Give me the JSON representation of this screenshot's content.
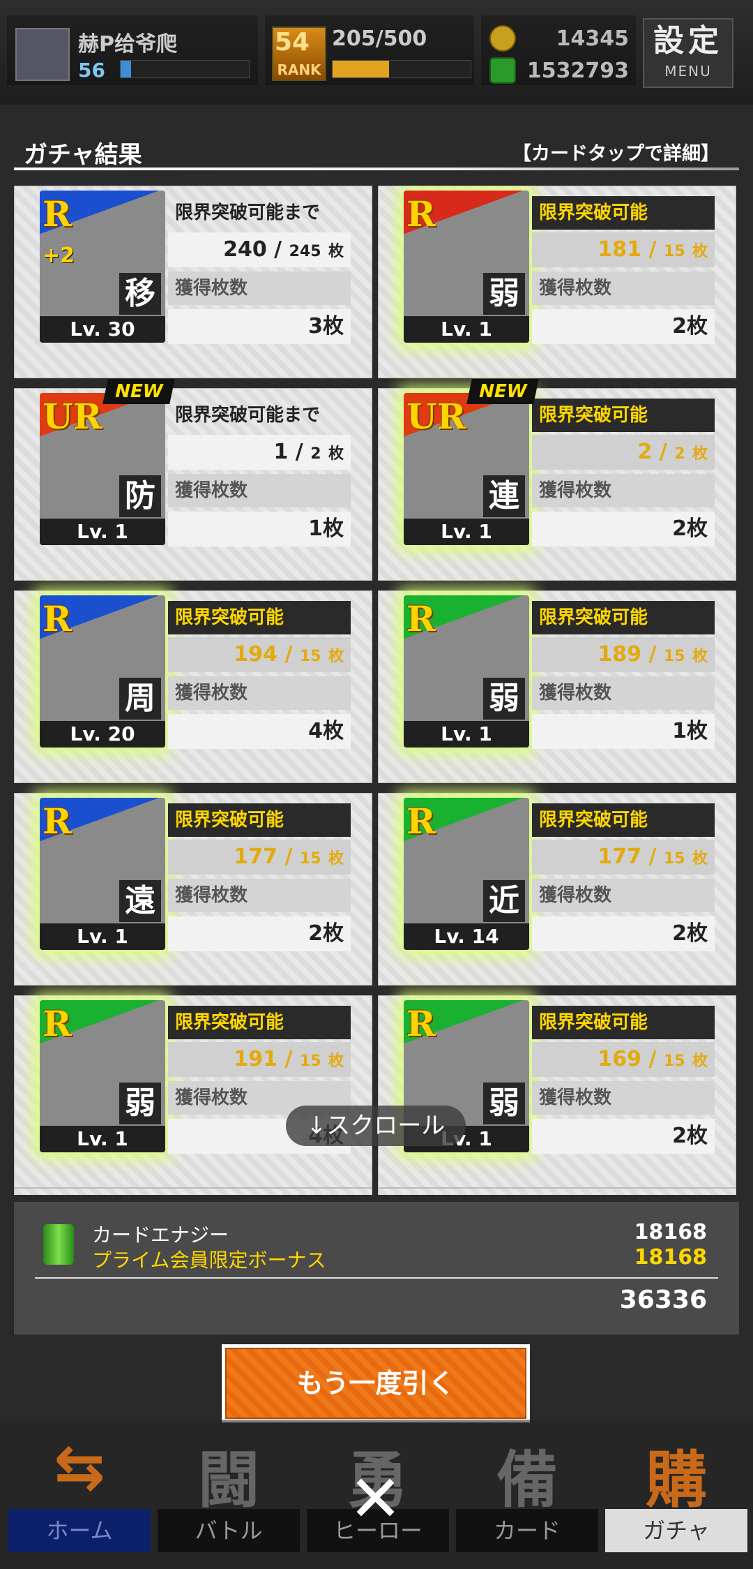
{
  "player": {
    "name": "赫P给爷爬",
    "level": "56",
    "xp_fraction": 0.08
  },
  "rank": {
    "label": "RANK",
    "value": "54",
    "progress": "205/500",
    "fraction": 0.41
  },
  "currency": {
    "coins": "14345",
    "energy": "1532793"
  },
  "menu": {
    "kanji": "設定",
    "label": "MENU"
  },
  "header": {
    "title": "ガチャ結果",
    "hint": "【カードタップで詳細】"
  },
  "cards": [
    {
      "rarity": "R",
      "plus": "+2",
      "kanji": "移",
      "level": "Lv. 30",
      "status": "限界突破可能まで",
      "owned": "240",
      "need": "245",
      "unit": "枚",
      "got_label": "獲得枚数",
      "got": "3枚",
      "new": false,
      "ready": false,
      "color": "#1a4fd0"
    },
    {
      "rarity": "R",
      "plus": "",
      "kanji": "弱",
      "level": "Lv. 1",
      "status": "限界突破可能",
      "owned": "181",
      "need": "15",
      "unit": "枚",
      "got_label": "獲得枚数",
      "got": "2枚",
      "new": false,
      "ready": true,
      "color": "#d82a1a"
    },
    {
      "rarity": "UR",
      "plus": "",
      "kanji": "防",
      "level": "Lv. 1",
      "status": "限界突破可能まで",
      "owned": "1",
      "need": "2",
      "unit": "枚",
      "got_label": "獲得枚数",
      "got": "1枚",
      "new": true,
      "new_label": "NEW",
      "ready": false,
      "color": "#e03a10"
    },
    {
      "rarity": "UR",
      "plus": "",
      "kanji": "連",
      "level": "Lv. 1",
      "status": "限界突破可能",
      "owned": "2",
      "need": "2",
      "unit": "枚",
      "got_label": "獲得枚数",
      "got": "2枚",
      "new": true,
      "new_label": "NEW",
      "ready": true,
      "color": "#e03a10"
    },
    {
      "rarity": "R",
      "plus": "",
      "kanji": "周",
      "level": "Lv. 20",
      "status": "限界突破可能",
      "owned": "194",
      "need": "15",
      "unit": "枚",
      "got_label": "獲得枚数",
      "got": "4枚",
      "new": false,
      "ready": true,
      "color": "#1a4fd0"
    },
    {
      "rarity": "R",
      "plus": "",
      "kanji": "弱",
      "level": "Lv. 1",
      "status": "限界突破可能",
      "owned": "189",
      "need": "15",
      "unit": "枚",
      "got_label": "獲得枚数",
      "got": "1枚",
      "new": false,
      "ready": true,
      "color": "#1ab030"
    },
    {
      "rarity": "R",
      "plus": "",
      "kanji": "遠",
      "level": "Lv. 1",
      "status": "限界突破可能",
      "owned": "177",
      "need": "15",
      "unit": "枚",
      "got_label": "獲得枚数",
      "got": "2枚",
      "new": false,
      "ready": true,
      "color": "#1a4fd0"
    },
    {
      "rarity": "R",
      "plus": "",
      "kanji": "近",
      "level": "Lv. 14",
      "status": "限界突破可能",
      "owned": "177",
      "need": "15",
      "unit": "枚",
      "got_label": "獲得枚数",
      "got": "2枚",
      "new": false,
      "ready": true,
      "color": "#1ab030"
    },
    {
      "rarity": "R",
      "plus": "",
      "kanji": "弱",
      "level": "Lv. 1",
      "status": "限界突破可能",
      "owned": "191",
      "need": "15",
      "unit": "枚",
      "got_label": "獲得枚数",
      "got": "4枚",
      "new": false,
      "ready": true,
      "color": "#1ab030"
    },
    {
      "rarity": "R",
      "plus": "",
      "kanji": "弱",
      "level": "Lv. 1",
      "status": "限界突破可能",
      "owned": "169",
      "need": "15",
      "unit": "枚",
      "got_label": "獲得枚数",
      "got": "2枚",
      "new": false,
      "ready": true,
      "color": "#1ab030"
    }
  ],
  "scroll_hint": "↓スクロール",
  "energy": {
    "label": "カードエナジー",
    "value": "18168",
    "bonus_label": "プライム会員限定ボーナス",
    "bonus_value": "18168",
    "total": "36336"
  },
  "retry_label": "もう一度引く",
  "nav": [
    {
      "kanji": "⇆",
      "label": "ホーム"
    },
    {
      "kanji": "闘",
      "label": "バトル"
    },
    {
      "kanji": "勇",
      "label": "ヒーロー"
    },
    {
      "kanji": "備",
      "label": "カード"
    },
    {
      "kanji": "購",
      "label": "ガチャ"
    }
  ]
}
